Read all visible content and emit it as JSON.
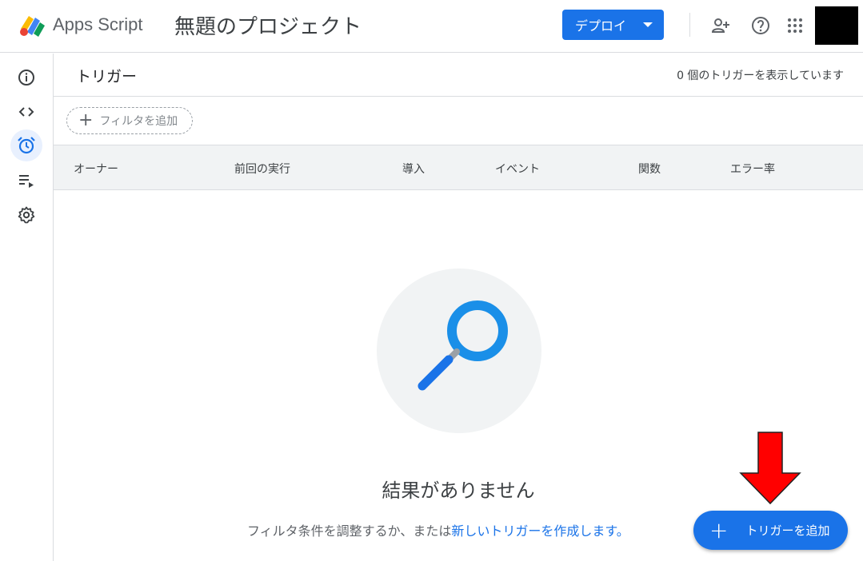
{
  "topbar": {
    "brand": "Apps Script",
    "project_title": "無題のプロジェクト",
    "deploy_label": "デプロイ",
    "icons": [
      "add-person-icon",
      "help-icon",
      "apps-grid-icon"
    ]
  },
  "rail": {
    "items": [
      {
        "name": "overview",
        "icon": "info-icon"
      },
      {
        "name": "editor",
        "icon": "code-icon"
      },
      {
        "name": "triggers",
        "icon": "alarm-clock-icon",
        "active": true
      },
      {
        "name": "executions",
        "icon": "executions-list-icon"
      },
      {
        "name": "settings",
        "icon": "gear-icon"
      }
    ]
  },
  "main": {
    "title": "トリガー",
    "count_text": "0 個のトリガーを表示しています",
    "filter_label": "フィルタを追加",
    "columns": [
      "オーナー",
      "前回の実行",
      "導入",
      "イベント",
      "関数",
      "エラー率"
    ],
    "empty_title": "結果がありません",
    "empty_sub_prefix": "フィルタ条件を調整するか、または",
    "empty_sub_link": "新しいトリガーを作成します。",
    "fab_label": "トリガーを追加"
  },
  "colors": {
    "accent": "#1a73e8",
    "arrow": "#ff0000",
    "magnifier": "#1a8fe8"
  }
}
